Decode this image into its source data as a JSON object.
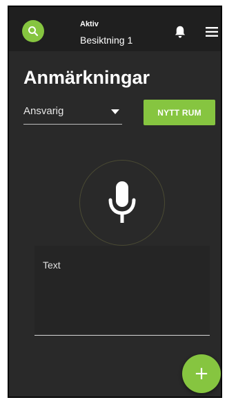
{
  "header": {
    "active_caption": "Aktiv",
    "active_value": "Besiktning 1",
    "icons": {
      "search": "search-icon",
      "notifications": "bell-icon",
      "menu": "hamburger-menu-icon"
    }
  },
  "page": {
    "title": "Anmärkningar"
  },
  "responsible_select": {
    "selected": "Ansvarig"
  },
  "new_room_button": {
    "label": "NYTT RUM"
  },
  "voice": {
    "icon": "microphone-icon"
  },
  "text_field": {
    "label": "Text"
  },
  "fab": {
    "glyph": "+",
    "icon": "plus-icon"
  },
  "colors": {
    "accent": "#86c540",
    "background": "#292929",
    "topbar": "#1f1f1f"
  }
}
